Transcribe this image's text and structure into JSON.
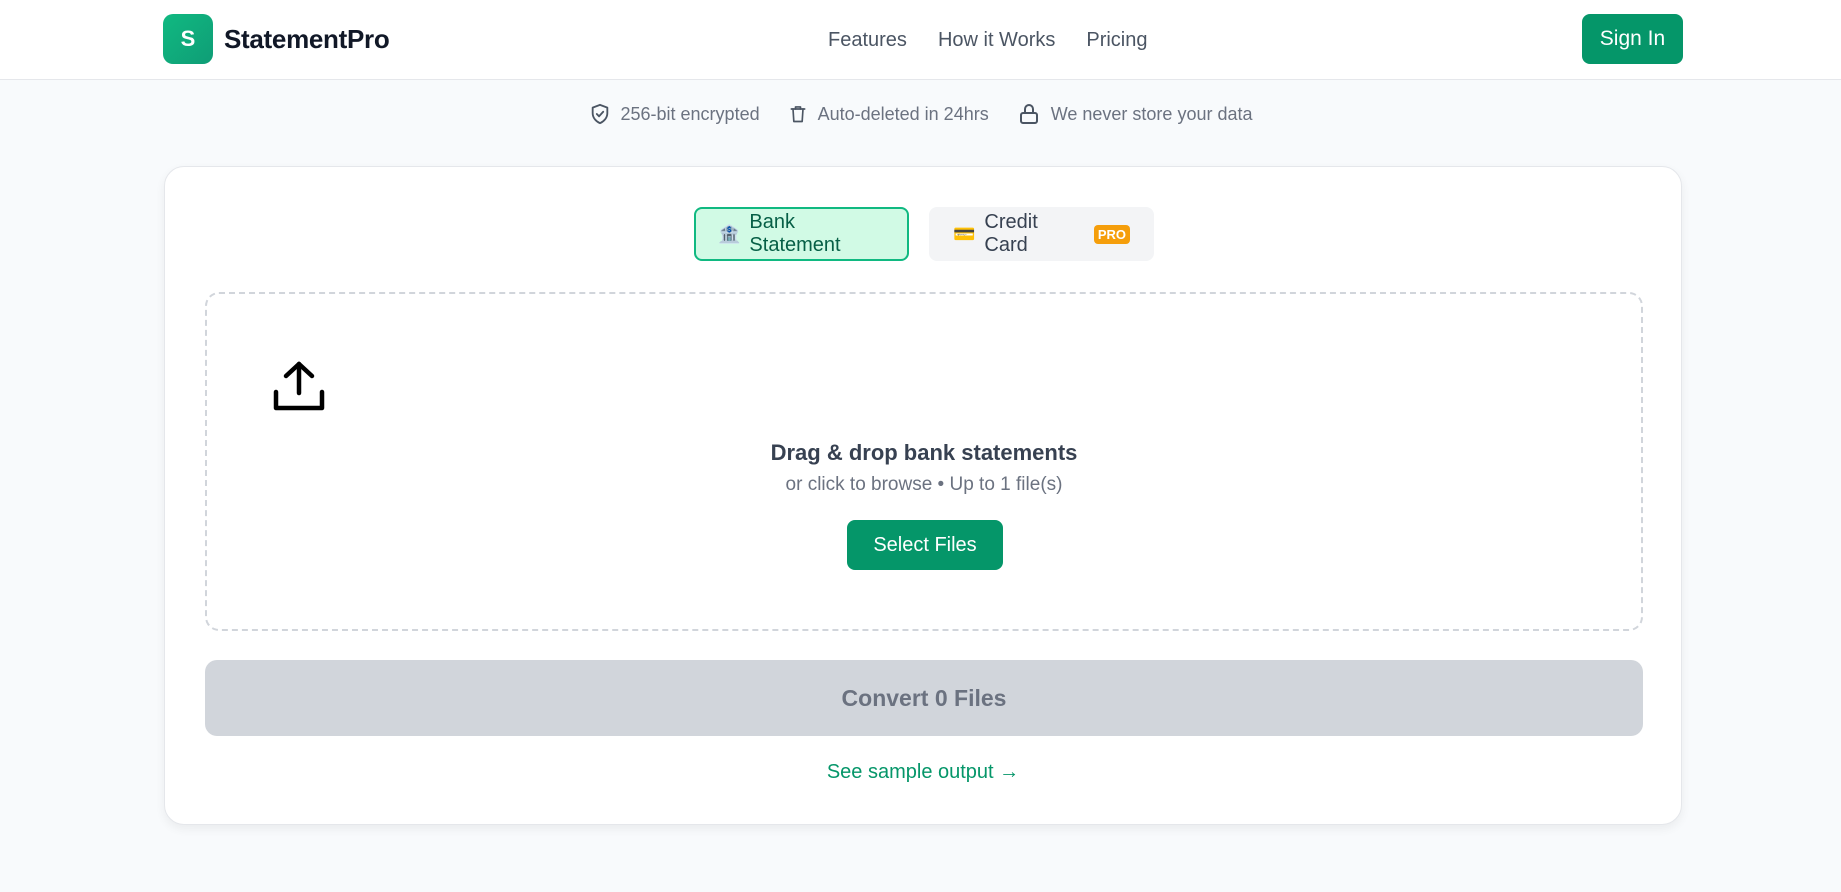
{
  "header": {
    "logo_letter": "S",
    "app_name": "StatementPro",
    "nav": [
      "Features",
      "How it Works",
      "Pricing"
    ],
    "signin_label": "Sign In"
  },
  "trust": [
    {
      "icon": "shield-check-icon",
      "text": "256-bit encrypted"
    },
    {
      "icon": "trash-icon",
      "text": "Auto-deleted in 24hrs"
    },
    {
      "icon": "lock-icon",
      "text": "We never store your data"
    }
  ],
  "tabs": [
    {
      "icon": "bank-emoji",
      "emoji": "🏦",
      "label": "Bank Statement",
      "active": true
    },
    {
      "icon": "credit-card-emoji",
      "emoji": "💳",
      "label": "Credit Card",
      "badge": "PRO",
      "active": false
    }
  ],
  "dropzone": {
    "icon": "upload-icon",
    "title": "Drag & drop bank statements",
    "subtitle": "or click to browse • Up to 1 file(s)",
    "button_label": "Select Files"
  },
  "convert_label": "Convert 0 Files",
  "sample_link": "See sample output →",
  "colors": {
    "brand": "#059669",
    "active_tab_bg": "#d1fae5",
    "pro_badge": "#f59e0b",
    "disabled": "#d1d5db"
  }
}
